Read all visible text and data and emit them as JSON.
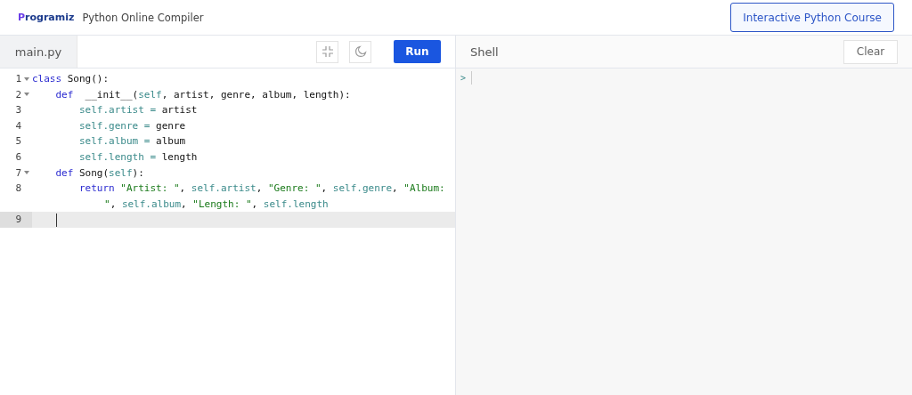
{
  "header": {
    "logo": "Programiz",
    "title": "Python Online Compiler",
    "course_button": "Interactive Python Course"
  },
  "editor": {
    "tab": {
      "label": "main.py",
      "selected": true
    },
    "run_button": "Run",
    "lines": [
      {
        "number": "1",
        "foldable": true,
        "active": false,
        "tokens": [
          {
            "kind": "kw",
            "text": "class"
          },
          {
            "kind": "plain",
            "text": " Song():"
          }
        ]
      },
      {
        "number": "2",
        "foldable": true,
        "active": false,
        "tokens": [
          {
            "kind": "kw",
            "text": "    def"
          },
          {
            "kind": "plain",
            "text": "  __init__("
          },
          {
            "kind": "self",
            "text": "self"
          },
          {
            "kind": "plain",
            "text": ", artist, genre, album, length):"
          }
        ]
      },
      {
        "number": "3",
        "foldable": false,
        "active": false,
        "tokens": [
          {
            "kind": "self",
            "text": "        self.artist ="
          },
          {
            "kind": "plain",
            "text": " artist"
          }
        ]
      },
      {
        "number": "4",
        "foldable": false,
        "active": false,
        "tokens": [
          {
            "kind": "self",
            "text": "        self.genre ="
          },
          {
            "kind": "plain",
            "text": " genre"
          }
        ]
      },
      {
        "number": "5",
        "foldable": false,
        "active": false,
        "tokens": [
          {
            "kind": "self",
            "text": "        self.album ="
          },
          {
            "kind": "plain",
            "text": " album"
          }
        ]
      },
      {
        "number": "6",
        "foldable": false,
        "active": false,
        "tokens": [
          {
            "kind": "self",
            "text": "        self.length ="
          },
          {
            "kind": "plain",
            "text": " length"
          }
        ]
      },
      {
        "number": "7",
        "foldable": true,
        "active": false,
        "tokens": [
          {
            "kind": "kw",
            "text": "    def"
          },
          {
            "kind": "plain",
            "text": " Song("
          },
          {
            "kind": "self",
            "text": "self"
          },
          {
            "kind": "plain",
            "text": "):"
          }
        ]
      },
      {
        "number": "8",
        "foldable": false,
        "active": false,
        "tokens": [
          {
            "kind": "kw",
            "text": "        return"
          },
          {
            "kind": "str",
            "text": " \"Artist: \""
          },
          {
            "kind": "plain",
            "text": ", "
          },
          {
            "kind": "self",
            "text": "self.artist"
          },
          {
            "kind": "plain",
            "text": ", "
          },
          {
            "kind": "str",
            "text": "\"Genre: \""
          },
          {
            "kind": "plain",
            "text": ", "
          },
          {
            "kind": "self",
            "text": "self.genre"
          },
          {
            "kind": "plain",
            "text": ", "
          },
          {
            "kind": "str",
            "text": "\"Album:"
          }
        ],
        "continuation": [
          {
            "kind": "str",
            "text": "\""
          },
          {
            "kind": "plain",
            "text": ", "
          },
          {
            "kind": "self",
            "text": "self.album"
          },
          {
            "kind": "plain",
            "text": ", "
          },
          {
            "kind": "str",
            "text": "\"Length: \""
          },
          {
            "kind": "plain",
            "text": ", "
          },
          {
            "kind": "self",
            "text": "self.length"
          }
        ]
      },
      {
        "number": "9",
        "foldable": false,
        "active": true
      }
    ]
  },
  "shell": {
    "title": "Shell",
    "clear_button": "Clear",
    "prompt": ">"
  }
}
